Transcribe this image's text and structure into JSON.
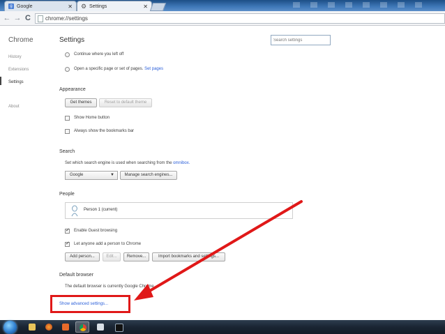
{
  "tabs": [
    {
      "title": "Google",
      "favicon": "google-favicon-icon",
      "active": false
    },
    {
      "title": "Settings",
      "favicon": "settings-gear-icon",
      "active": true
    }
  ],
  "toolbar": {
    "back_icon": "back-arrow-icon",
    "forward_icon": "forward-arrow-icon",
    "reload_icon": "reload-icon",
    "url": "chrome://settings"
  },
  "sidebar": {
    "title": "Chrome",
    "items": [
      {
        "label": "History"
      },
      {
        "label": "Extensions"
      },
      {
        "label": "Settings",
        "active": true
      },
      {
        "label": "About"
      }
    ]
  },
  "main": {
    "title": "Settings",
    "search_placeholder": "Search settings",
    "on_startup": {
      "option_continue": "Continue where you left off",
      "option_specific": "Open a specific page or set of pages.",
      "set_pages_link": "Set pages"
    },
    "appearance": {
      "heading": "Appearance",
      "get_themes": "Get themes",
      "reset_theme": "Reset to default theme",
      "show_home": "Show Home button",
      "show_bookmarks": "Always show the bookmarks bar"
    },
    "search": {
      "heading": "Search",
      "description": "Set which search engine is used when searching from the",
      "omnibox_link": "omnibox.",
      "engine": "Google",
      "manage": "Manage search engines..."
    },
    "people": {
      "heading": "People",
      "person": "Person 1 (current)",
      "guest": "Enable Guest browsing",
      "let_anyone": "Let anyone add a person to Chrome",
      "add": "Add person...",
      "edit": "Edit...",
      "remove": "Remove...",
      "import": "Import bookmarks and settings..."
    },
    "default_browser": {
      "heading": "Default browser",
      "description": "The default browser is currently Google Chrome."
    },
    "advanced_link": "Show advanced settings..."
  },
  "annotation_color": "#e01818",
  "taskbar": {
    "icons": [
      "windows-start-icon",
      "file-explorer-icon",
      "firefox-icon",
      "media-player-icon",
      "chrome-icon",
      "notepad-icon",
      "cmd-icon"
    ]
  }
}
